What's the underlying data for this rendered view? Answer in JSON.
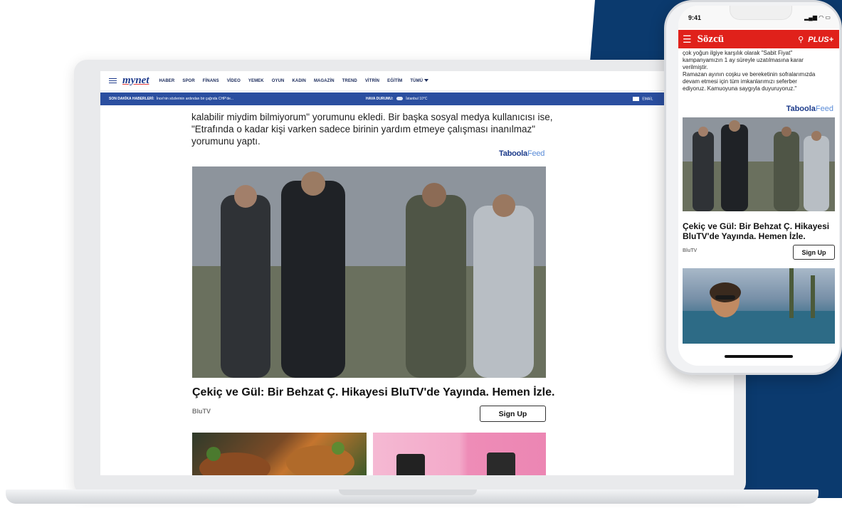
{
  "colors": {
    "navy": "#0b3a6e",
    "mynet_blue": "#1f3b8c",
    "breaking_bar": "#2b4fa0",
    "sozcu_red": "#e0211b",
    "taboola_navy": "#1b3a8a",
    "taboola_light": "#5a8cd8"
  },
  "laptop": {
    "logo": "mynet",
    "nav": [
      "HABER",
      "SPOR",
      "FİNANS",
      "VİDEO",
      "YEMEK",
      "OYUN",
      "KADIN",
      "MAGAZİN",
      "TREND",
      "VİTRİN",
      "EĞİTİM",
      "TÜMÜ"
    ],
    "icons": {
      "menu": "hamburger-icon",
      "search": "search-icon",
      "weather": "cloud-icon",
      "email": "mail-icon",
      "more": "chevron-down-icon"
    },
    "breaking": {
      "label": "SON DAKİKA HABERLERİ:",
      "headline": "İnce'nin sözlerinin ardından bir çağrıda CHP'de..."
    },
    "weather": {
      "label": "HAVA DURUMU:",
      "value": "İstanbul 10°C"
    },
    "email_label": "EMAİL",
    "article_lines": [
      "kalabilir miydim bilmiyorum\" yorumunu ekledi. Bir başka sosyal medya kullanıcısı ise,",
      "\"Etrafında o kadar kişi varken sadece birinin yardım etmeye çalışması inanılmaz\"",
      "yorumunu yaptı."
    ],
    "taboola": {
      "brand": "Taboola",
      "feed": "Feed"
    },
    "card": {
      "title": "Çekiç ve Gül: Bir Behzat Ç. Hikayesi BluTV'de Yayında. Hemen İzle.",
      "brand": "BluTV",
      "button": "Sign Up"
    }
  },
  "phone": {
    "time": "9:41",
    "status_icons": "signal-wifi-battery",
    "logo": "Sözcü",
    "plus_label": "PLUS+",
    "icons": {
      "menu": "hamburger-icon",
      "search": "search-icon"
    },
    "article_lines": [
      "çok yoğun ilgiye karşılık olarak \"Sabit Fiyat\"",
      "kampanyamızın 1 ay süreyle uzatılmasına karar",
      "verilmiştir.",
      "Ramazan ayının coşku ve bereketinin sofralarımızda",
      "devam etmesi için tüm imkanlarımızı seferber",
      "ediyoruz. Kamuoyuna saygıyla duyuruyoruz.\""
    ],
    "taboola": {
      "brand": "Taboola",
      "feed": "Feed"
    },
    "card": {
      "title": "Çekiç ve Gül: Bir Behzat Ç. Hikayesi BluTV'de Yayında. Hemen İzle.",
      "brand": "BluTV",
      "button": "Sign Up"
    }
  }
}
